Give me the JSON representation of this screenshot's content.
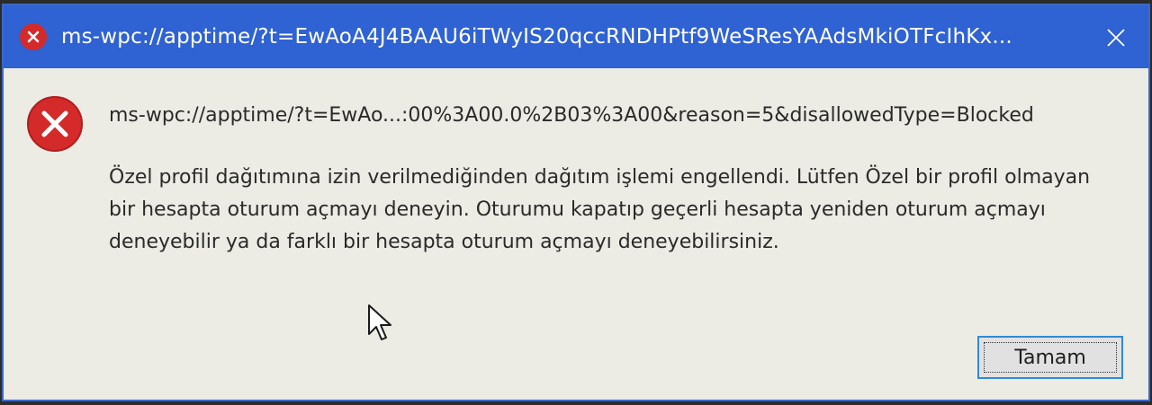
{
  "window": {
    "title": "ms-wpc://apptime/?t=EwAoA4J4BAAU6iTWyIS20qccRNDHPtf9WeSResYAAdsMkiOTFcIhKx...",
    "title_icon": "error-icon",
    "close_icon": "close-icon"
  },
  "dialog": {
    "icon": "error-icon",
    "headline": "ms-wpc://apptime/?t=EwAo...:00%3A00.0%2B03%3A00&reason=5&disallowedType=Blocked",
    "message": "Özel profil dağıtımına izin verilmediğinden dağıtım işlemi engellendi. Lütfen Özel bir profil olmayan bir hesapta oturum açmayı deneyin. Oturumu kapatıp geçerli hesapta yeniden oturum açmayı deneyebilir ya da farklı bir hesapta oturum açmayı deneyebilirsiniz.",
    "ok_label": "Tamam"
  },
  "colors": {
    "titlebar": "#2f62d3",
    "error_red": "#d42a2a",
    "dialog_background": "#ecebe4",
    "button_focus_border": "#2f8ad8"
  }
}
